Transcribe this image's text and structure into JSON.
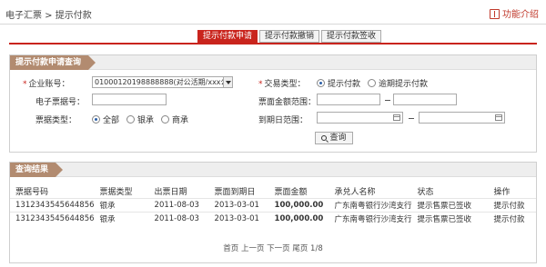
{
  "header": {
    "breadcrumb": "电子汇票 > 提示付款",
    "help_label": "功能介绍"
  },
  "tabs": [
    {
      "label": "提示付款申请",
      "active": true
    },
    {
      "label": "提示付款撤销",
      "active": false
    },
    {
      "label": "提示付款签收",
      "active": false
    }
  ],
  "query_panel": {
    "title": "提示付款申请查询",
    "account_label": "企业账号：",
    "account_value": "01000120198888888(对公活期/xxx公",
    "draft_no_label": "电子票据号：",
    "draft_no_value": "",
    "bill_type_label": "票据类型：",
    "bill_type_options": [
      "全部",
      "银承",
      "商承"
    ],
    "bill_type_selected": "全部",
    "trade_type_label": "交易类型：",
    "trade_type_options": [
      "提示付款",
      "逾期提示付款"
    ],
    "trade_type_selected": "提示付款",
    "amount_range_label": "票面金额范围：",
    "amount_from": "",
    "amount_to": "",
    "due_range_label": "到期日范围：",
    "due_from": "",
    "due_to": "",
    "query_button": "查询",
    "required_mark": "*"
  },
  "results_panel": {
    "title": "查询结果",
    "columns": [
      "票据号码",
      "票据类型",
      "出票日期",
      "票面到期日",
      "票面金额",
      "承兑人名称",
      "状态",
      "操作"
    ],
    "rows": [
      {
        "draft_no": "1312343545644856",
        "bill_type": "银承",
        "issue_date": "2011-08-03",
        "due_date": "2013-03-01",
        "amount": "100,000.00",
        "acceptor": "广东南粤银行沙湾支行",
        "status": "提示售票已签收",
        "action": "提示付款"
      },
      {
        "draft_no": "1312343545644856",
        "bill_type": "银承",
        "issue_date": "2011-08-03",
        "due_date": "2013-03-01",
        "amount": "100,000.00",
        "acceptor": "广东南粤银行沙湾支行",
        "status": "提示售票已签收",
        "action": "提示付款"
      }
    ],
    "pager": "首页 上一页 下一页 尾页 1/8"
  },
  "colors": {
    "accent_red": "#c9241d",
    "panel_title_bg": "#b28b70"
  }
}
